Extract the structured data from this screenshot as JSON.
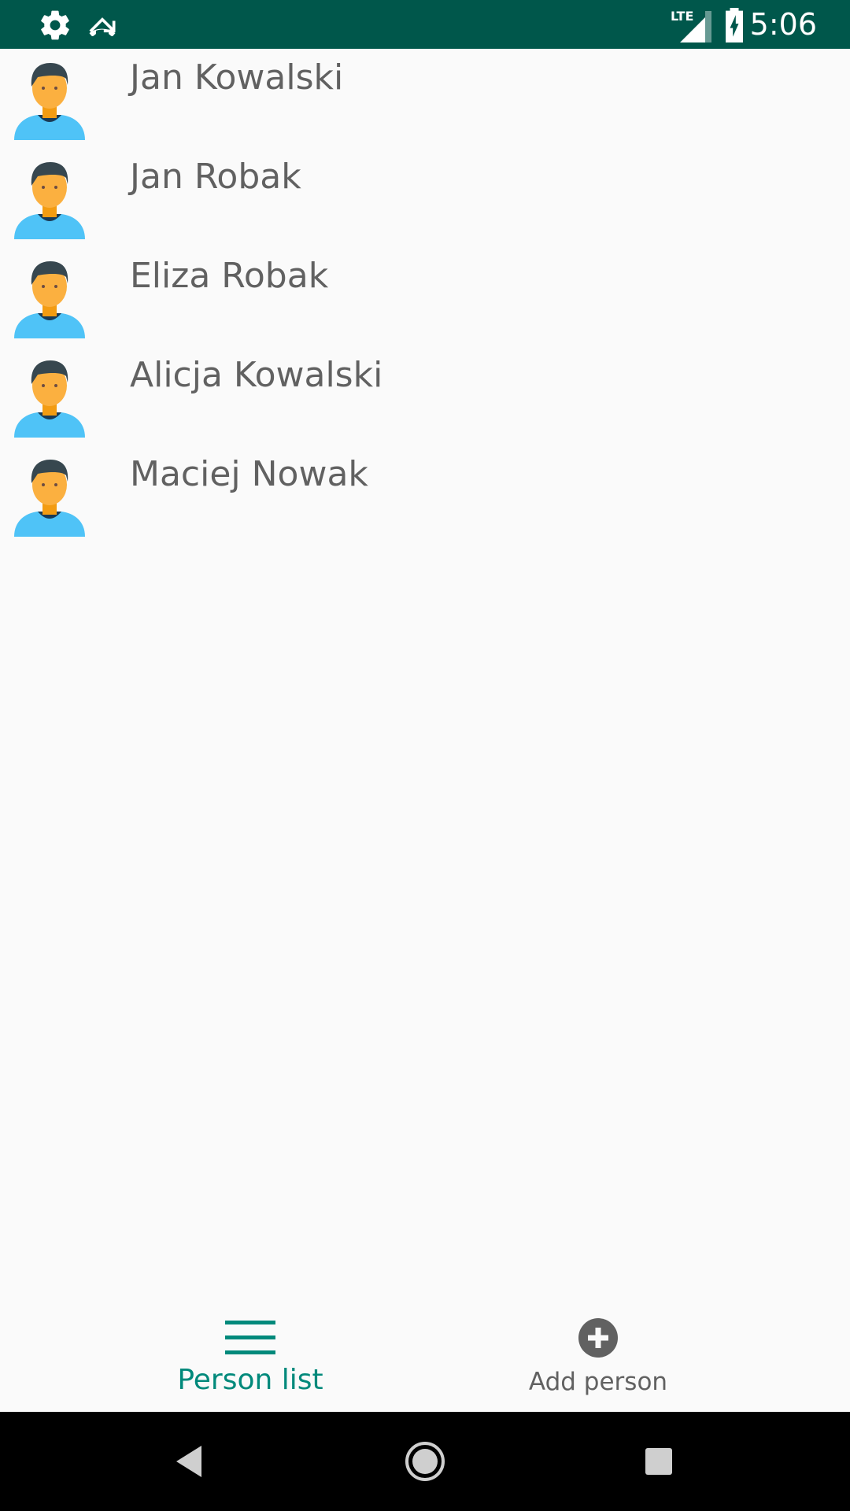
{
  "status_bar": {
    "time": "5:06",
    "network_label": "LTE",
    "icons": [
      "gear-icon",
      "missed-call-icon",
      "lte-signal-icon",
      "battery-charging-icon"
    ],
    "background_color": "#00574b"
  },
  "person_list": {
    "items": [
      {
        "name": "Jan Kowalski",
        "icon": "person-avatar-icon"
      },
      {
        "name": "Jan Robak",
        "icon": "person-avatar-icon"
      },
      {
        "name": "Eliza Robak",
        "icon": "person-avatar-icon"
      },
      {
        "name": "Alicja Kowalski",
        "icon": "person-avatar-icon"
      },
      {
        "name": "Maciej Nowak",
        "icon": "person-avatar-icon"
      }
    ]
  },
  "bottom_nav": {
    "items": [
      {
        "label": "Person list",
        "icon": "list-menu-icon",
        "active": true
      },
      {
        "label": "Add person",
        "icon": "add-circle-icon",
        "active": false
      }
    ],
    "active_color": "#00897b",
    "inactive_color": "#616161"
  },
  "system_nav": {
    "buttons": [
      "back-icon",
      "home-icon",
      "recents-icon"
    ]
  }
}
